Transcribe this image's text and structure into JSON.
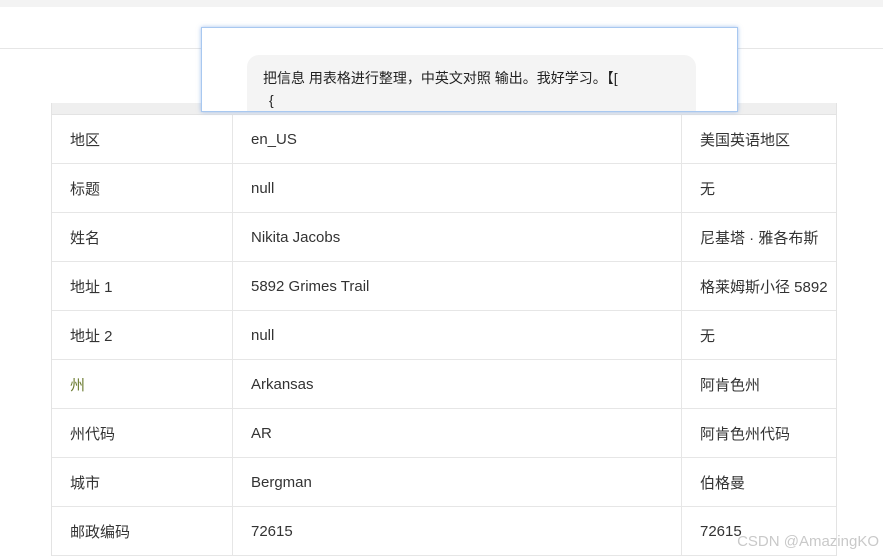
{
  "prompt": {
    "line1": "把信息 用表格进行整理，中英文对照 输出。我好学习。【[",
    "line2": "{"
  },
  "rows": [
    {
      "label": "地区",
      "value": "en_US",
      "translation": "美国英语地区"
    },
    {
      "label": "标题",
      "value": "null",
      "translation": "无"
    },
    {
      "label": "姓名",
      "value": "Nikita Jacobs",
      "translation": "尼基塔 · 雅各布斯"
    },
    {
      "label": "地址 1",
      "value": "5892 Grimes Trail",
      "translation": "格莱姆斯小径 5892"
    },
    {
      "label": "地址 2",
      "value": "null",
      "translation": "无"
    },
    {
      "label": "州",
      "value": "Arkansas",
      "translation": "阿肯色州"
    },
    {
      "label": "州代码",
      "value": "AR",
      "translation": "阿肯色州代码"
    },
    {
      "label": "城市",
      "value": "Bergman",
      "translation": "伯格曼"
    },
    {
      "label": "邮政编码",
      "value": "72615",
      "translation": "72615"
    }
  ],
  "watermark": "CSDN @AmazingKO"
}
